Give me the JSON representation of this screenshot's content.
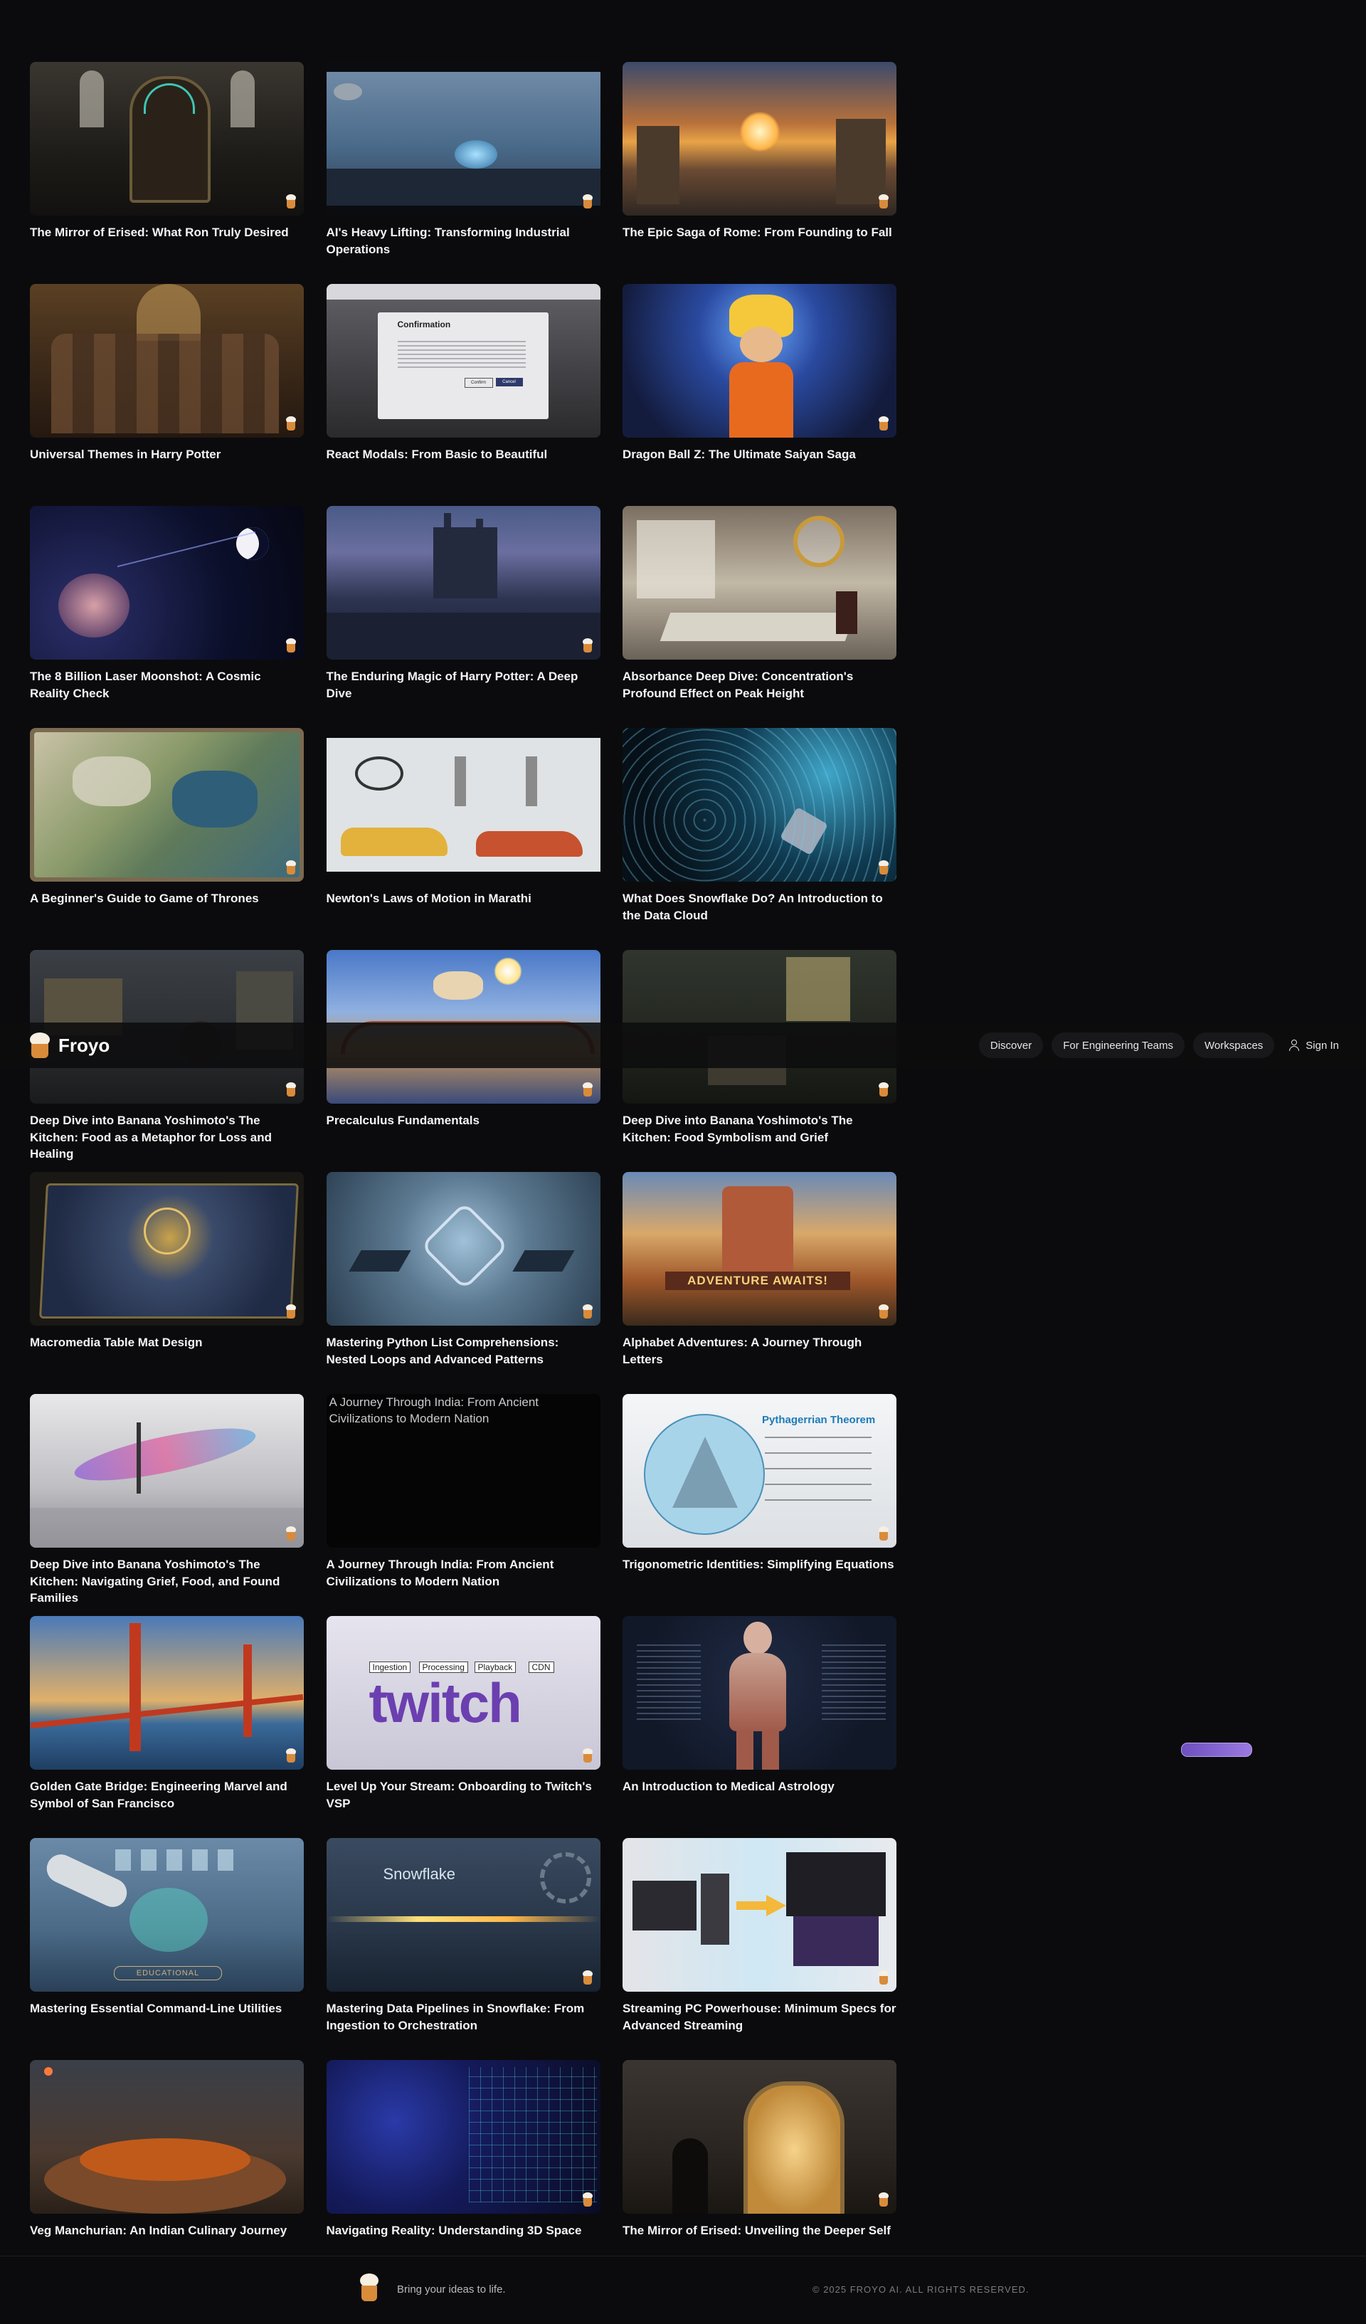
{
  "header": {
    "brand": "Froyo",
    "nav": [
      "Discover",
      "For Engineering Teams",
      "Workspaces"
    ],
    "sign_in": "Sign In"
  },
  "cards": [
    {
      "title": "The Mirror of Erised: What Ron Truly Desired"
    },
    {
      "title": "AI's Heavy Lifting: Transforming Industrial Operations"
    },
    {
      "title": "The Epic Saga of Rome: From Founding to Fall"
    },
    {
      "title": "Universal Themes in Harry Potter"
    },
    {
      "title": "React Modals: From Basic to Beautiful",
      "modal_heading": "Confirmation",
      "modal_buttons": [
        "Confirm",
        "Cancel"
      ]
    },
    {
      "title": "Dragon Ball Z: The Ultimate Saiyan Saga"
    },
    {
      "title": "The 8 Billion Laser Moonshot: A Cosmic Reality Check"
    },
    {
      "title": "The Enduring Magic of Harry Potter: A Deep Dive"
    },
    {
      "title": "Absorbance Deep Dive: Concentration's Profound Effect on Peak Height"
    },
    {
      "title": "A Beginner's Guide to Game of Thrones"
    },
    {
      "title": "Newton's Laws of Motion in Marathi"
    },
    {
      "title": "What Does Snowflake Do? An Introduction to the Data Cloud"
    },
    {
      "title": "Deep Dive into Banana Yoshimoto's The Kitchen: Food as a Metaphor for Loss and Healing"
    },
    {
      "title": "Precalculus Fundamentals"
    },
    {
      "title": "Deep Dive into Banana Yoshimoto's The Kitchen: Food Symbolism and Grief"
    },
    {
      "title": "Macromedia Table Mat Design"
    },
    {
      "title": "Mastering Python List Comprehensions: Nested Loops and Advanced Patterns"
    },
    {
      "title": "Alphabet Adventures: A Journey Through Letters",
      "banner": "ADVENTURE AWAITS!"
    },
    {
      "title": "Deep Dive into Banana Yoshimoto's The Kitchen: Navigating Grief, Food, and Found Families"
    },
    {
      "title": "A Journey Through India: From Ancient Civilizations to Modern Nation",
      "alt": "A Journey Through India: From Ancient Civilizations to Modern Nation"
    },
    {
      "title": "Trigonometric Identities: Simplifying Equations",
      "heading": "Pythagerrian Theorem"
    },
    {
      "title": "Golden Gate Bridge: Engineering Marvel and Symbol of San Francisco"
    },
    {
      "title": "Level Up Your Stream: Onboarding to Twitch's VSP",
      "logo": "twitch",
      "labels": [
        "Ingestion",
        "Processing",
        "Playback",
        "CDN"
      ]
    },
    {
      "title": "An Introduction to Medical Astrology"
    },
    {
      "title": "Mastering Essential Command-Line Utilities",
      "badge": "EDUCATIONAL"
    },
    {
      "title": "Mastering Data Pipelines in Snowflake: From Ingestion to Orchestration",
      "logo": "Snowflake"
    },
    {
      "title": "Streaming PC Powerhouse: Minimum Specs for Advanced Streaming"
    },
    {
      "title": "Veg Manchurian: An Indian Culinary Journey"
    },
    {
      "title": "Navigating Reality: Understanding 3D Space"
    },
    {
      "title": "The Mirror of Erised: Unveiling the Deeper Self"
    }
  ],
  "footer": {
    "tagline": "Bring your ideas to life.",
    "copyright": "© 2025 FROYO AI. ALL RIGHTS RESERVED."
  },
  "icons": [
    "froyo-logo-icon",
    "user-icon",
    "froyo-mascot-icon"
  ],
  "colors": {
    "background": "#0b0b0d",
    "accent": "#d98b3a",
    "card_title": "#f4f4f5"
  }
}
